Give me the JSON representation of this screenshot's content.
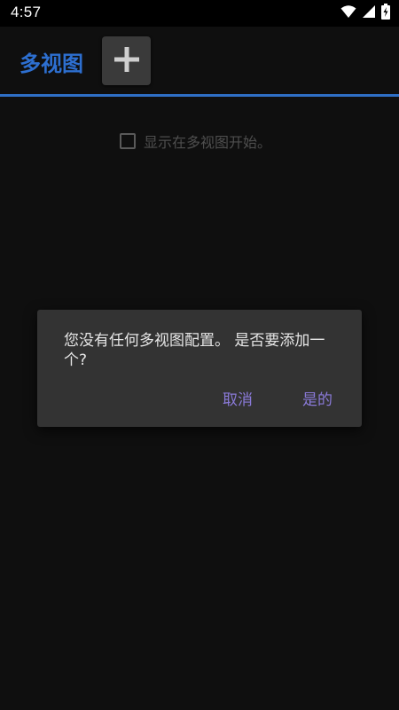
{
  "status_bar": {
    "time": "4:57",
    "icons": [
      "wifi-icon",
      "signal-icon",
      "battery-charging-icon"
    ]
  },
  "action_bar": {
    "title": "多视图",
    "add_icon": "plus-icon"
  },
  "settings": {
    "show_on_start_label": "显示在多视图开始。",
    "show_on_start_checked": false
  },
  "dialog": {
    "message": "您没有任何多视图配置。 是否要添加一个?",
    "cancel_label": "取消",
    "confirm_label": "是的"
  },
  "colors": {
    "accent": "#2d6fd0",
    "dialog_button": "#8a7ad8",
    "dialog_background": "#333333",
    "background": "#0f0f0f"
  }
}
